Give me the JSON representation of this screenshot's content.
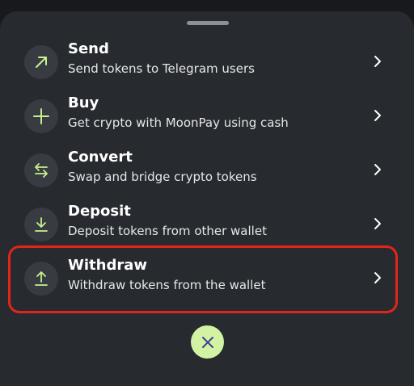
{
  "colors": {
    "sheet_bg": "#272a2f",
    "icon_bg": "#383c42",
    "icon_accent": "#c8f08f",
    "close_bg": "#d3f2a4",
    "close_icon": "#3b3f8f",
    "highlight": "#e0261a"
  },
  "menu": {
    "items": [
      {
        "title": "Send",
        "subtitle": "Send tokens to Telegram users",
        "icon": "arrow-up-right-icon"
      },
      {
        "title": "Buy",
        "subtitle": "Get crypto with MoonPay using cash",
        "icon": "plus-icon"
      },
      {
        "title": "Convert",
        "subtitle": "Swap and bridge crypto tokens",
        "icon": "swap-arrows-icon"
      },
      {
        "title": "Deposit",
        "subtitle": "Deposit tokens from other wallet",
        "icon": "download-icon"
      },
      {
        "title": "Withdraw",
        "subtitle": "Withdraw tokens from the wallet",
        "icon": "upload-icon"
      }
    ]
  },
  "close_button": {
    "icon": "close-icon"
  }
}
